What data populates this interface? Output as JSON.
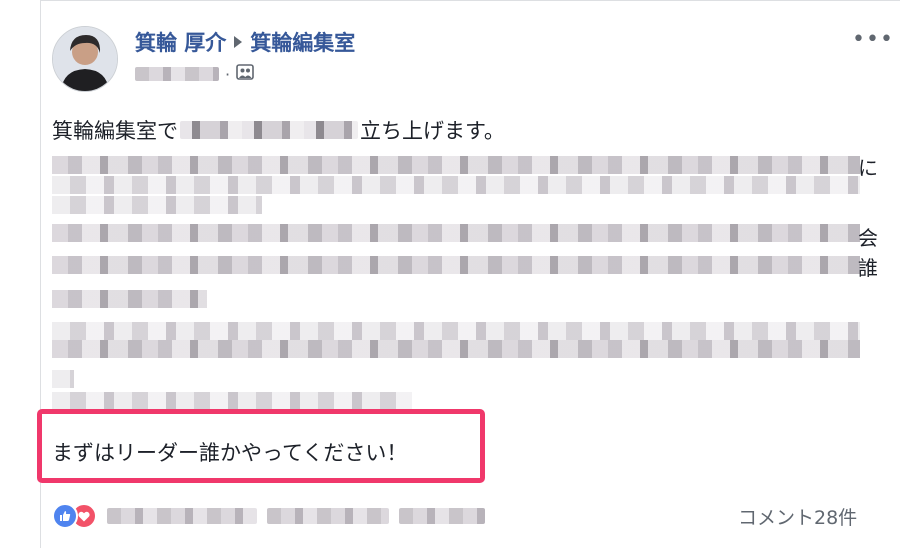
{
  "post": {
    "author": "箕輪 厚介",
    "target_page": "箕輪編集室",
    "more_label": "•••",
    "text_line1_start": "箕輪編集室で",
    "text_line1_end": "立ち上げます。",
    "text_emphasis": "まずはリーダー誰かやってください！",
    "edge_chars": [
      "に",
      "会",
      "誰"
    ]
  },
  "footer": {
    "comment_count": "コメント28件"
  },
  "colors": {
    "link": "#365899",
    "highlight_border": "#f0386b",
    "like": "#4f84ef",
    "love": "#f25268"
  },
  "icons": {
    "audience": "group-audience-icon",
    "like": "thumbs-up-icon",
    "love": "heart-icon",
    "more": "more-options-icon"
  }
}
